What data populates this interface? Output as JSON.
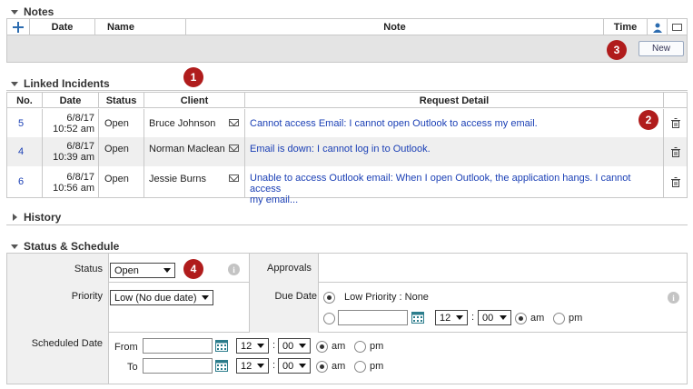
{
  "notes": {
    "title": "Notes",
    "columns": {
      "date": "Date",
      "name": "Name",
      "note": "Note",
      "time": "Time"
    },
    "new_button": "New"
  },
  "linked": {
    "title": "Linked Incidents",
    "columns": {
      "no": "No.",
      "date": "Date",
      "status": "Status",
      "client": "Client",
      "detail": "Request Detail"
    },
    "rows": [
      {
        "no": "5",
        "date1": "6/8/17",
        "date2": "10:52 am",
        "status": "Open",
        "client": "Bruce Johnson",
        "detail": "Cannot access Email: I cannot open Outlook to access my email.",
        "detail2": ""
      },
      {
        "no": "4",
        "date1": "6/8/17",
        "date2": "10:39 am",
        "status": "Open",
        "client": "Norman Maclean",
        "detail": "Email is down: I cannot log in to Outlook.",
        "detail2": ""
      },
      {
        "no": "6",
        "date1": "6/8/17",
        "date2": "10:56 am",
        "status": "Open",
        "client": "Jessie Burns",
        "detail": "Unable to access Outlook email: When I open Outlook, the application hangs. I cannot access",
        "detail2": "my email..."
      }
    ]
  },
  "history": {
    "title": "History"
  },
  "status_schedule": {
    "title": "Status & Schedule",
    "status_label": "Status",
    "status_value": "Open",
    "approvals_label": "Approvals",
    "priority_label": "Priority",
    "priority_value": "Low (No due date)",
    "due_date_label": "Due Date",
    "due_option_text": "Low  Priority : None",
    "due_hour": "12",
    "due_min": "00",
    "am": "am",
    "pm": "pm",
    "colon": ":",
    "scheduled_label": "Scheduled Date",
    "from_label": "From",
    "to_label": "To",
    "from_hour": "12",
    "from_min": "00",
    "to_hour": "12",
    "to_min": "00"
  },
  "badges": [
    "1",
    "2",
    "3",
    "4"
  ]
}
